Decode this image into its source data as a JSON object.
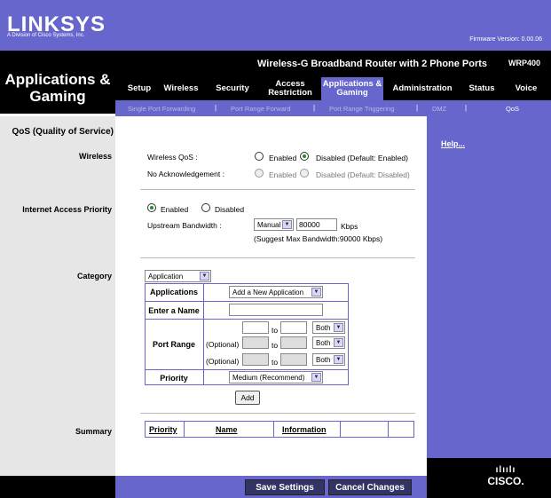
{
  "brand": {
    "logo": "LINKSYS",
    "subtitle": "A Division of Cisco Systems, Inc.",
    "firmware": "Firmware Version: 0.00.06",
    "product": "Wireless-G Broadband Router with 2 Phone Ports",
    "model": "WRP400",
    "cisco": "CISCO."
  },
  "section_title": "Applications & Gaming",
  "tabs": [
    {
      "label": "Setup"
    },
    {
      "label": "Wireless"
    },
    {
      "label": "Security"
    },
    {
      "label": "Access Restriction"
    },
    {
      "label": "Applications & Gaming"
    },
    {
      "label": "Administration"
    },
    {
      "label": "Status"
    },
    {
      "label": "Voice"
    }
  ],
  "subtabs": [
    {
      "label": "Single Port Forwarding"
    },
    {
      "label": "Port Range Forward"
    },
    {
      "label": "Port Range Triggering"
    },
    {
      "label": "DMZ"
    },
    {
      "label": "QoS"
    }
  ],
  "left": {
    "qos_title": "QoS (Quality of Service)",
    "wireless": "Wireless",
    "internet_priority": "Internet Access Priority",
    "category": "Category",
    "summary": "Summary"
  },
  "help": "Help...",
  "wireless": {
    "qos_label": "Wireless QoS :",
    "noack_label": "No Acknowledgement :",
    "enabled": "Enabled",
    "disabled": "Disabled",
    "qos_default": "Disabled (Default: Enabled)",
    "noack_default": "Disabled (Default: Disabled)"
  },
  "internet": {
    "enabled": "Enabled",
    "disabled": "Disabled",
    "upstream_label": "Upstream Bandwidth :",
    "mode": "Manual",
    "value": "80000",
    "unit": "Kbps",
    "suggest": "(Suggest Max Bandwidth:90000 Kbps)"
  },
  "category": {
    "select": "Application",
    "applications_label": "Applications",
    "applications_value": "Add a New Application",
    "enter_name_label": "Enter a Name",
    "port_range_label": "Port Range",
    "optional": "(Optional)",
    "to": "to",
    "both": "Both",
    "priority_label": "Priority",
    "priority_value": "Medium (Recommend)",
    "add": "Add"
  },
  "summary": {
    "priority": "Priority",
    "name": "Name",
    "information": "Information"
  },
  "footer": {
    "save": "Save Settings",
    "cancel": "Cancel Changes"
  }
}
